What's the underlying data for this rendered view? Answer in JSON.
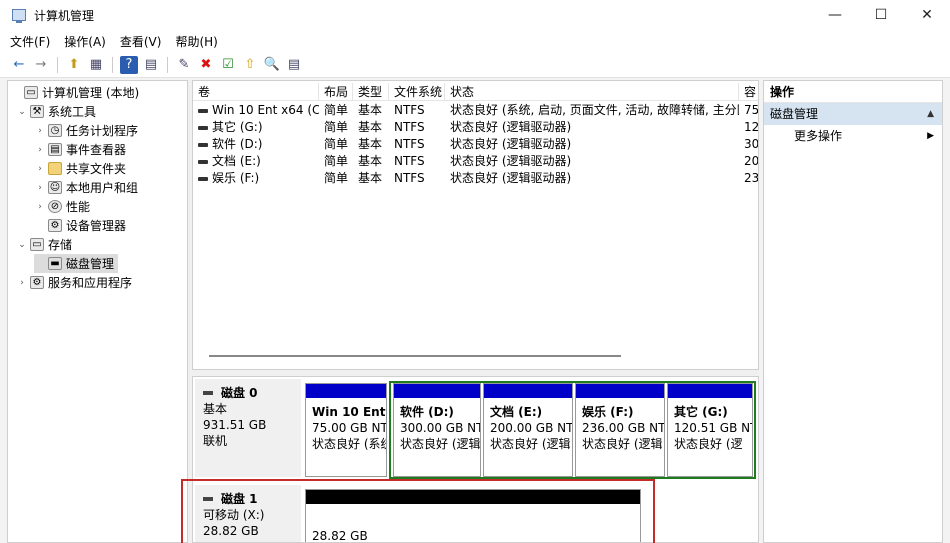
{
  "window": {
    "title": "计算机管理",
    "buttons": [
      "—",
      "☐",
      "✕"
    ]
  },
  "menu": [
    "文件(F)",
    "操作(A)",
    "查看(V)",
    "帮助(H)"
  ],
  "toolbar": [
    "←",
    "→",
    "⬆",
    "▦",
    "?",
    "▤",
    "✎",
    "✖",
    "☑",
    "⇧",
    "🔍",
    "▤"
  ],
  "tree": [
    {
      "label": "计算机管理 (本地)",
      "level": 0,
      "arrow": "",
      "icon": "computer-icon"
    },
    {
      "label": "系统工具",
      "level": 1,
      "arrow": "⌄",
      "icon": "tools-icon"
    },
    {
      "label": "任务计划程序",
      "level": 2,
      "arrow": "›",
      "icon": "clock-icon"
    },
    {
      "label": "事件查看器",
      "level": 2,
      "arrow": "›",
      "icon": "event-icon"
    },
    {
      "label": "共享文件夹",
      "level": 2,
      "arrow": "›",
      "icon": "folder-icon"
    },
    {
      "label": "本地用户和组",
      "level": 2,
      "arrow": "›",
      "icon": "users-icon"
    },
    {
      "label": "性能",
      "level": 2,
      "arrow": "›",
      "icon": "performance-icon"
    },
    {
      "label": "设备管理器",
      "level": 2,
      "arrow": "",
      "icon": "device-icon"
    },
    {
      "label": "存储",
      "level": 1,
      "arrow": "⌄",
      "icon": "storage-icon"
    },
    {
      "label": "磁盘管理",
      "level": 2,
      "arrow": "",
      "icon": "disk-icon"
    },
    {
      "label": "服务和应用程序",
      "level": 1,
      "arrow": "›",
      "icon": "services-icon"
    }
  ],
  "columns": [
    "卷",
    "布局",
    "类型",
    "文件系统",
    "状态",
    "容"
  ],
  "volumes": [
    {
      "name": "Win 10 Ent x64 (C:)",
      "layout": "简单",
      "type": "基本",
      "fs": "NTFS",
      "status": "状态良好 (系统, 启动, 页面文件, 活动, 故障转储, 主分区)",
      "cap": "75"
    },
    {
      "name": "其它 (G:)",
      "layout": "简单",
      "type": "基本",
      "fs": "NTFS",
      "status": "状态良好 (逻辑驱动器)",
      "cap": "12"
    },
    {
      "name": "软件 (D:)",
      "layout": "简单",
      "type": "基本",
      "fs": "NTFS",
      "status": "状态良好 (逻辑驱动器)",
      "cap": "30"
    },
    {
      "name": "文档 (E:)",
      "layout": "简单",
      "type": "基本",
      "fs": "NTFS",
      "status": "状态良好 (逻辑驱动器)",
      "cap": "20"
    },
    {
      "name": "娱乐 (F:)",
      "layout": "简单",
      "type": "基本",
      "fs": "NTFS",
      "status": "状态良好 (逻辑驱动器)",
      "cap": "23"
    }
  ],
  "disk0": {
    "title": "磁盘 0",
    "kind": "基本",
    "size": "931.51 GB",
    "state": "联机"
  },
  "disk0_parts": [
    {
      "name": "Win 10 Ent",
      "size": "75.00 GB NT",
      "status": "状态良好 (系统"
    },
    {
      "name": "软件  (D:)",
      "size": "300.00 GB NT",
      "status": "状态良好 (逻辑"
    },
    {
      "name": "文档  (E:)",
      "size": "200.00 GB NT",
      "status": "状态良好 (逻辑"
    },
    {
      "name": "娱乐  (F:)",
      "size": "236.00 GB NT",
      "status": "状态良好 (逻辑"
    },
    {
      "name": "其它  (G:)",
      "size": "120.51 GB NT",
      "status": "状态良好 (逻"
    }
  ],
  "disk1": {
    "title": "磁盘 1",
    "kind": "可移动 (X:)",
    "size": "28.82 GB"
  },
  "disk1_part": {
    "size": "28.82 GB"
  },
  "actions": {
    "header": "操作",
    "section": "磁盘管理",
    "more": "更多操作"
  },
  "colors": {
    "primary_partition": "#0000c8",
    "logical_partition": "#0000c8",
    "unallocated": "#000000",
    "extended_border": "#1e7b1e",
    "highlight_box": "#c42b2b"
  }
}
